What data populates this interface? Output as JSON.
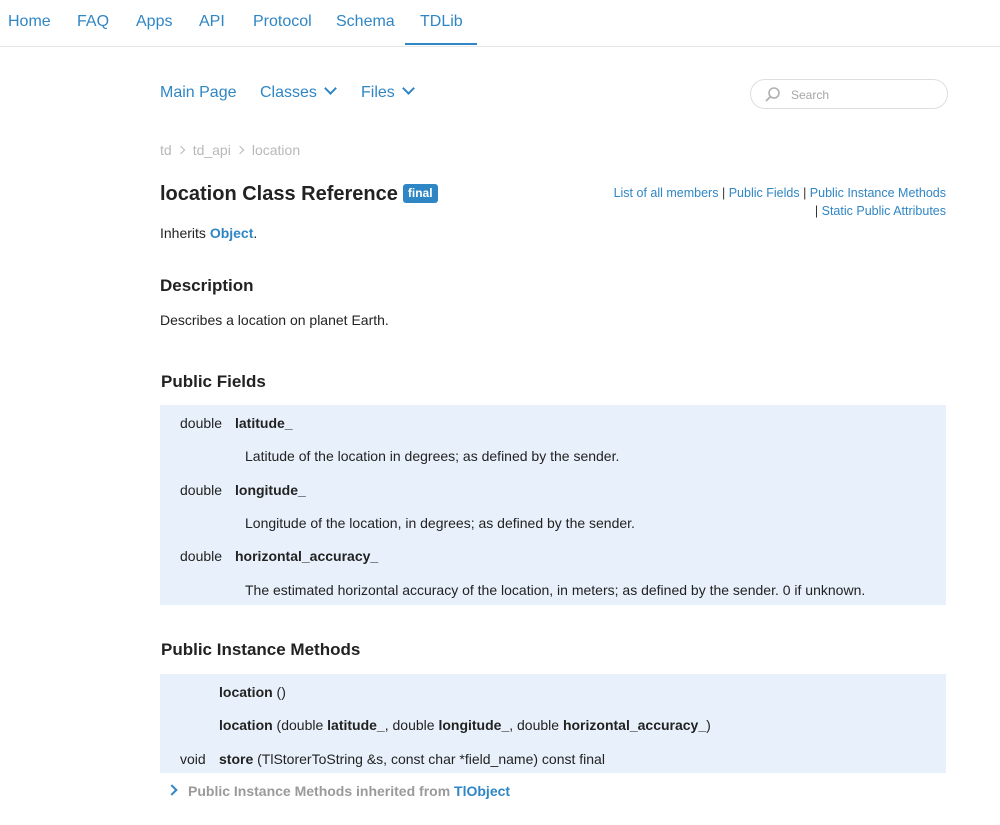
{
  "topnav": {
    "items": [
      {
        "label": "Home"
      },
      {
        "label": "FAQ"
      },
      {
        "label": "Apps"
      },
      {
        "label": "API"
      },
      {
        "label": "Protocol"
      },
      {
        "label": "Schema"
      },
      {
        "label": "TDLib",
        "active": true
      }
    ]
  },
  "subnav": {
    "main_page": "Main Page",
    "classes": "Classes",
    "files": "Files"
  },
  "search": {
    "placeholder": "Search",
    "value": ""
  },
  "breadcrumb": [
    "td",
    "td_api",
    "location"
  ],
  "header": {
    "title": "location Class Reference",
    "badge": "final",
    "links": {
      "all_members": "List of all members",
      "public_fields": "Public Fields",
      "public_instance_methods": "Public Instance Methods",
      "static_public_attributes": "Static Public Attributes",
      "separator": "|"
    }
  },
  "inherits": {
    "prefix": "Inherits",
    "class": "Object",
    "suffix": "."
  },
  "description": {
    "heading": "Description",
    "text": "Describes a location on planet Earth."
  },
  "public_fields": {
    "heading": "Public Fields",
    "fields": [
      {
        "type": "double",
        "name": "latitude_",
        "desc": "Latitude of the location in degrees; as defined by the sender."
      },
      {
        "type": "double",
        "name": "longitude_",
        "desc": "Longitude of the location, in degrees; as defined by the sender."
      },
      {
        "type": "double",
        "name": "horizontal_accuracy_",
        "desc": "The estimated horizontal accuracy of the location, in meters; as defined by the sender. 0 if unknown."
      }
    ]
  },
  "public_instance_methods": {
    "heading": "Public Instance Methods",
    "ctor1": {
      "name": "location",
      "args": " ()"
    },
    "ctor2": {
      "name": "location",
      "open": " (double ",
      "p1": "latitude_",
      "mid1": ", double ",
      "p2": "longitude_",
      "mid2": ", double ",
      "p3": "horizontal_accuracy_",
      "close": ")"
    },
    "store": {
      "type": "void",
      "name": "store",
      "args": " (TlStorerToString &s, const char *field_name) const final"
    }
  },
  "inherited": {
    "prefix": "Public Instance Methods inherited from ",
    "class": "TlObject"
  },
  "colors": {
    "accent": "#2f86c5",
    "block_bg": "#e8f1fb",
    "muted": "#b8b8b8"
  }
}
